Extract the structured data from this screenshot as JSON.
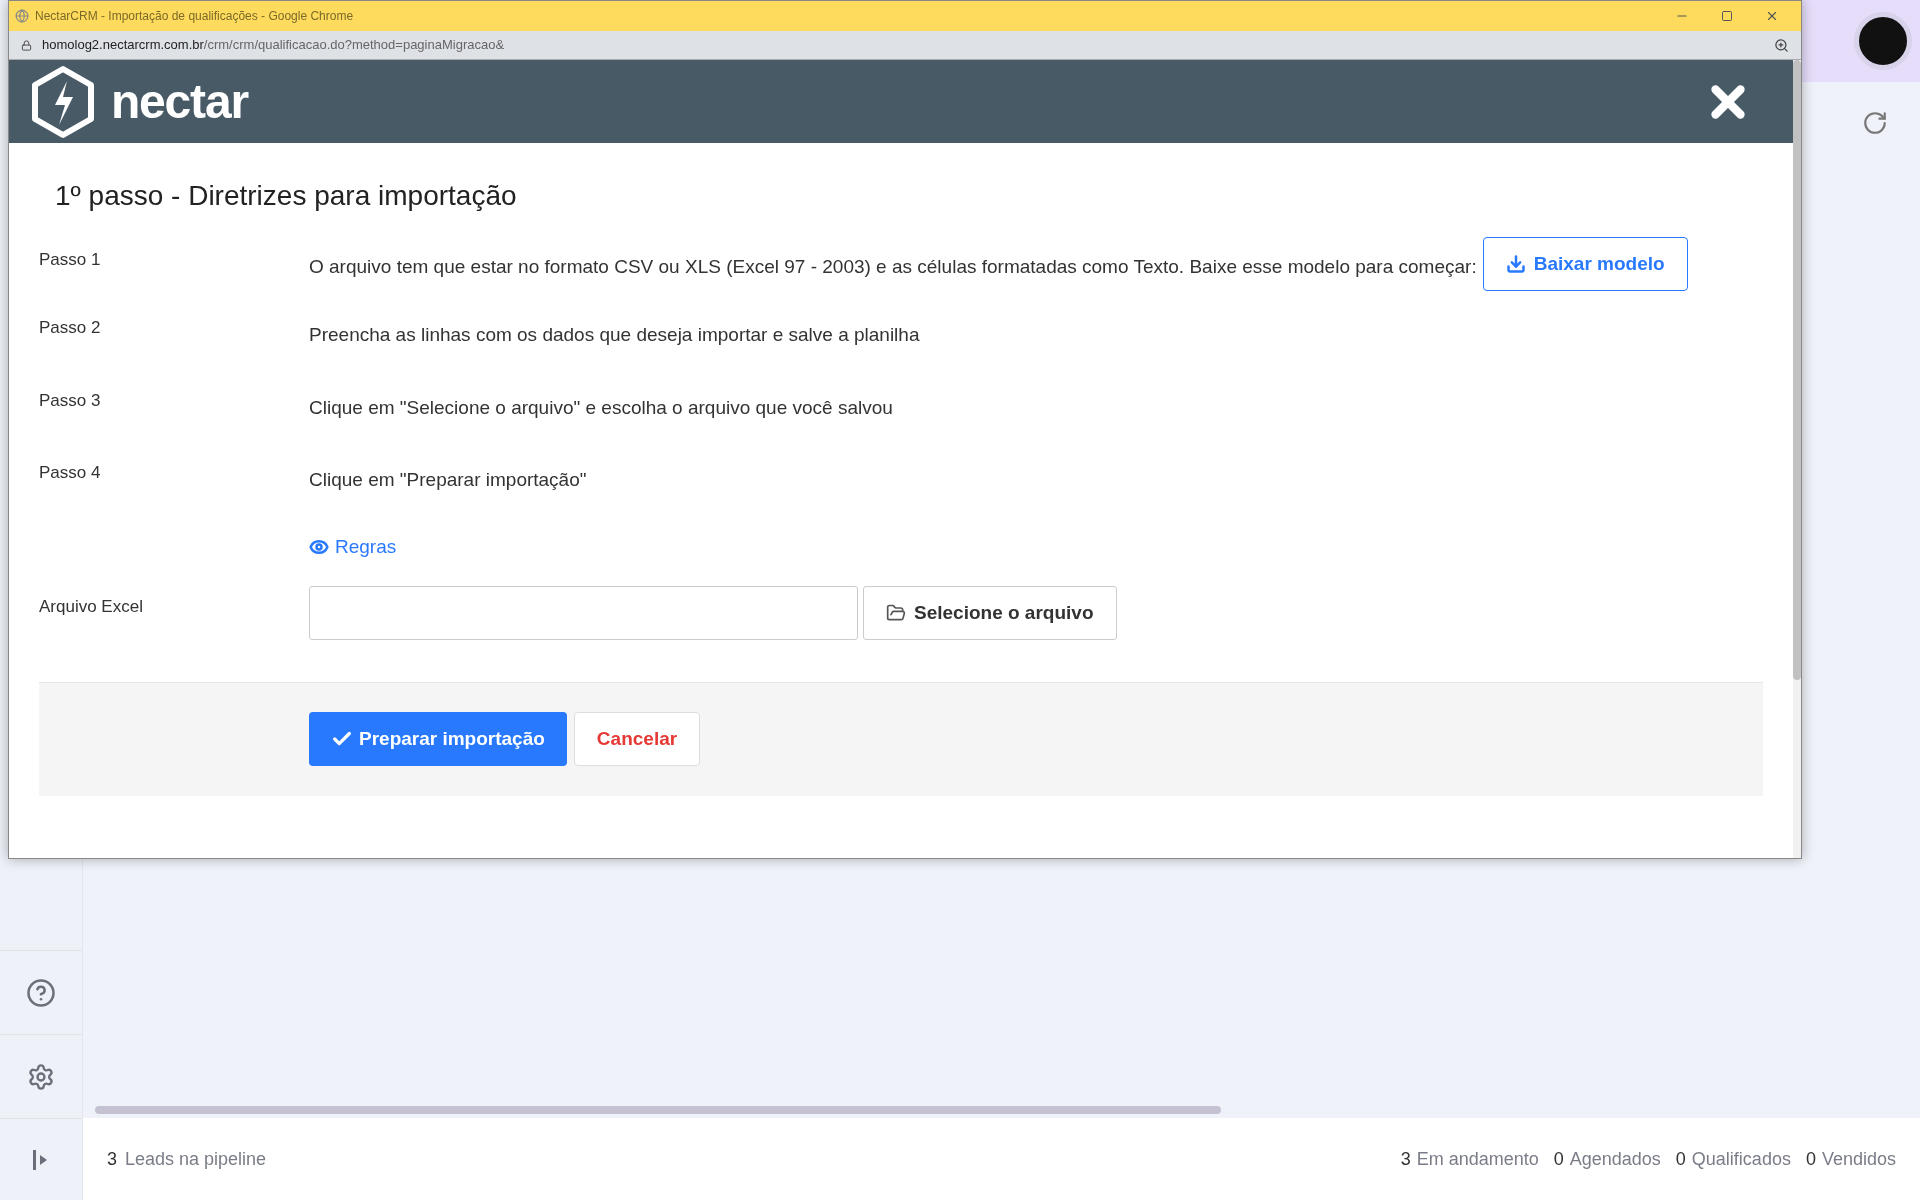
{
  "browser_window": {
    "title": "NectarCRM - Importação de qualificações - Google Chrome",
    "url_host": "homolog2.nectarcrm.com.br",
    "url_path": "/crm/crm/qualificacao.do?method=paginaMigracao&"
  },
  "modal": {
    "logo_text": "nectar",
    "heading": "1º passo - Diretrizes para importação",
    "steps": [
      {
        "label": "Passo 1",
        "text": "O arquivo tem que estar no formato CSV ou XLS (Excel 97 - 2003) e as células formatadas como Texto. Baixe esse modelo para começar:",
        "button": "Baixar modelo"
      },
      {
        "label": "Passo 2",
        "text": "Preencha as linhas com os dados que deseja importar e salve a planilha"
      },
      {
        "label": "Passo 3",
        "text": "Clique em \"Selecione o arquivo\" e escolha o arquivo que você salvou"
      },
      {
        "label": "Passo 4",
        "text": "Clique em \"Preparar importação\""
      }
    ],
    "rules_link": "Regras",
    "file_field": {
      "label": "Arquivo Excel",
      "button": "Selecione o arquivo"
    },
    "buttons": {
      "primary": "Preparar importação",
      "cancel": "Cancelar"
    }
  },
  "status_bar": {
    "leads_count": "3",
    "leads_label": "Leads na pipeline",
    "stats": [
      {
        "count": "3",
        "label": "Em andamento"
      },
      {
        "count": "0",
        "label": "Agendados"
      },
      {
        "count": "0",
        "label": "Qualificados"
      },
      {
        "count": "0",
        "label": "Vendidos"
      }
    ]
  }
}
